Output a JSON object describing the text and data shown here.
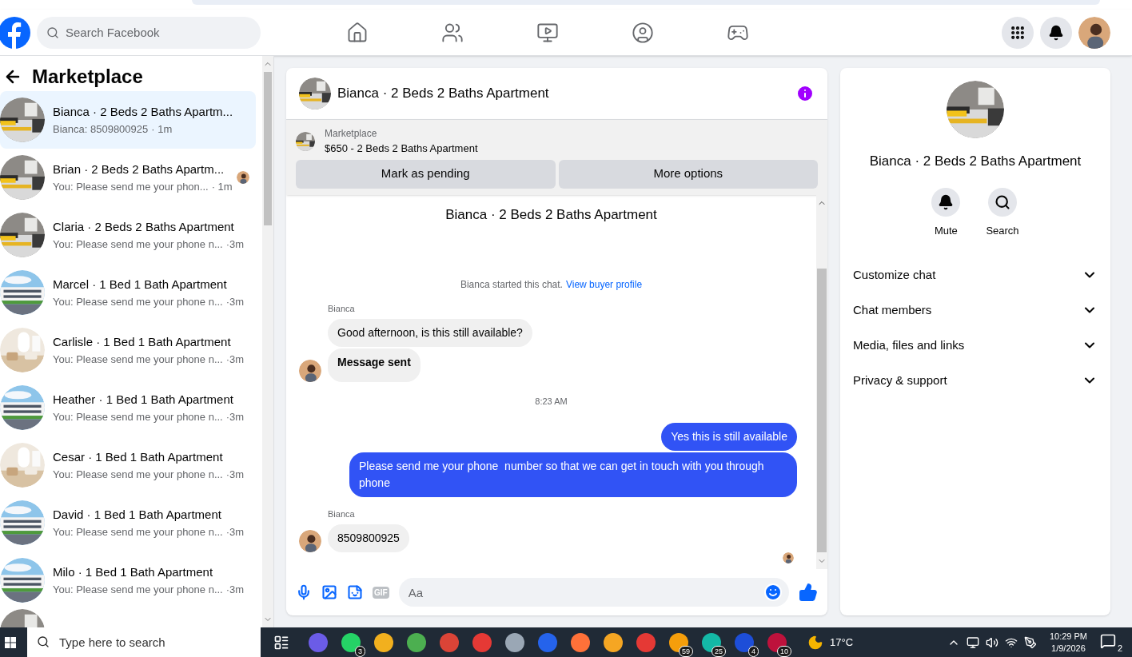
{
  "header": {
    "search_placeholder": "Search Facebook",
    "nav": [
      {
        "kind": "home"
      },
      {
        "kind": "friends"
      },
      {
        "kind": "video"
      },
      {
        "kind": "groups"
      },
      {
        "kind": "gaming"
      }
    ]
  },
  "sidebar": {
    "title": "Marketplace",
    "conversations": [
      {
        "title": "Bianca · 2 Beds 2 Baths Apartm...",
        "preview": "Bianca: 8509800925",
        "time": "· 1m",
        "selected": true,
        "kind": "bedroom",
        "seen": false
      },
      {
        "title": "Brian · 2 Beds 2 Baths Apartm...",
        "preview": "You: Please send me your phon...",
        "time": "· 1m",
        "selected": false,
        "kind": "bedroom",
        "seen": true
      },
      {
        "title": "Claria · 2 Beds 2 Baths Apartment",
        "preview": "You: Please send me your phone n...",
        "time": "·3m",
        "selected": false,
        "kind": "bedroom",
        "seen": false
      },
      {
        "title": "Marcel · 1 Bed 1 Bath Apartment",
        "preview": "You: Please send me your phone n...",
        "time": "·3m",
        "selected": false,
        "kind": "building",
        "seen": false
      },
      {
        "title": "Carlisle · 1 Bed 1 Bath Apartment",
        "preview": "You: Please send me your phone n...",
        "time": "·3m",
        "selected": false,
        "kind": "living",
        "seen": false
      },
      {
        "title": "Heather · 1 Bed 1 Bath Apartment",
        "preview": "You: Please send me your phone n...",
        "time": "·3m",
        "selected": false,
        "kind": "building",
        "seen": false
      },
      {
        "title": "Cesar · 1 Bed 1 Bath Apartment",
        "preview": "You: Please send me your phone n...",
        "time": "·3m",
        "selected": false,
        "kind": "living",
        "seen": false
      },
      {
        "title": "David · 1 Bed 1 Bath Apartment",
        "preview": "You: Please send me your phone n...",
        "time": "·3m",
        "selected": false,
        "kind": "building",
        "seen": false
      },
      {
        "title": "Milo · 1 Bed 1 Bath Apartment",
        "preview": "You: Please send me your phone n...",
        "time": "·3m",
        "selected": false,
        "kind": "building",
        "seen": false
      }
    ]
  },
  "chat": {
    "title": "Bianca · 2 Beds 2 Baths Apartment",
    "listing": {
      "label": "Marketplace",
      "item": "$650 - 2 Beds 2 Baths Apartment",
      "buttons": [
        "Mark as pending",
        "More options"
      ]
    },
    "intro_title": "Bianca · 2 Beds 2 Baths Apartment",
    "started": "Bianca started this chat.",
    "profile_link": "View buyer profile",
    "messages": [
      {
        "kind": "sender",
        "text": "Bianca"
      },
      {
        "kind": "incoming",
        "text": "Good afternoon, is this still available?",
        "bold": false,
        "avatar": false
      },
      {
        "kind": "incoming",
        "text": "Message sent",
        "bold": true,
        "avatar": true
      },
      {
        "kind": "time",
        "text": "8:23 AM"
      },
      {
        "kind": "outgoing",
        "text": "Yes this is still available"
      },
      {
        "kind": "outgoing",
        "text": "Please send me your phone  number so that we can get in touch with you through phone"
      },
      {
        "kind": "sender",
        "text": "Bianca"
      },
      {
        "kind": "incoming",
        "text": "8509800925",
        "bold": false,
        "avatar": true
      }
    ],
    "seen": true,
    "composer": {
      "placeholder": "Aa",
      "gif": "GIF"
    }
  },
  "details": {
    "title": "Bianca · 2 Beds 2 Baths Apartment",
    "actions": [
      {
        "kind": "mute",
        "label": "Mute"
      },
      {
        "kind": "search",
        "label": "Search"
      }
    ],
    "sections": [
      "Customize chat",
      "Chat members",
      "Media, files and links",
      "Privacy & support"
    ]
  },
  "taskbar": {
    "search_placeholder": "Type here to search",
    "apps": [
      {
        "color": "#6b5ce7"
      },
      {
        "color": "#25d366",
        "badge": "3"
      },
      {
        "color": "#f2b01e"
      },
      {
        "color": "#4caf50"
      },
      {
        "color": "#db4437"
      },
      {
        "color": "#e53935"
      },
      {
        "color": "#9aa7b5"
      },
      {
        "color": "#2563eb"
      },
      {
        "color": "#ff7139"
      },
      {
        "color": "#f5a623"
      },
      {
        "color": "#e53935"
      },
      {
        "color": "#f59e0b",
        "badge": "59"
      },
      {
        "color": "#14b8a6",
        "badge": "25"
      },
      {
        "color": "#1d4ed8",
        "badge": "4"
      },
      {
        "color": "#be123c",
        "badge": "10"
      }
    ],
    "temperature": "17°C",
    "time": "10:29 PM",
    "date": "1/9/2026",
    "notifications": "2"
  }
}
